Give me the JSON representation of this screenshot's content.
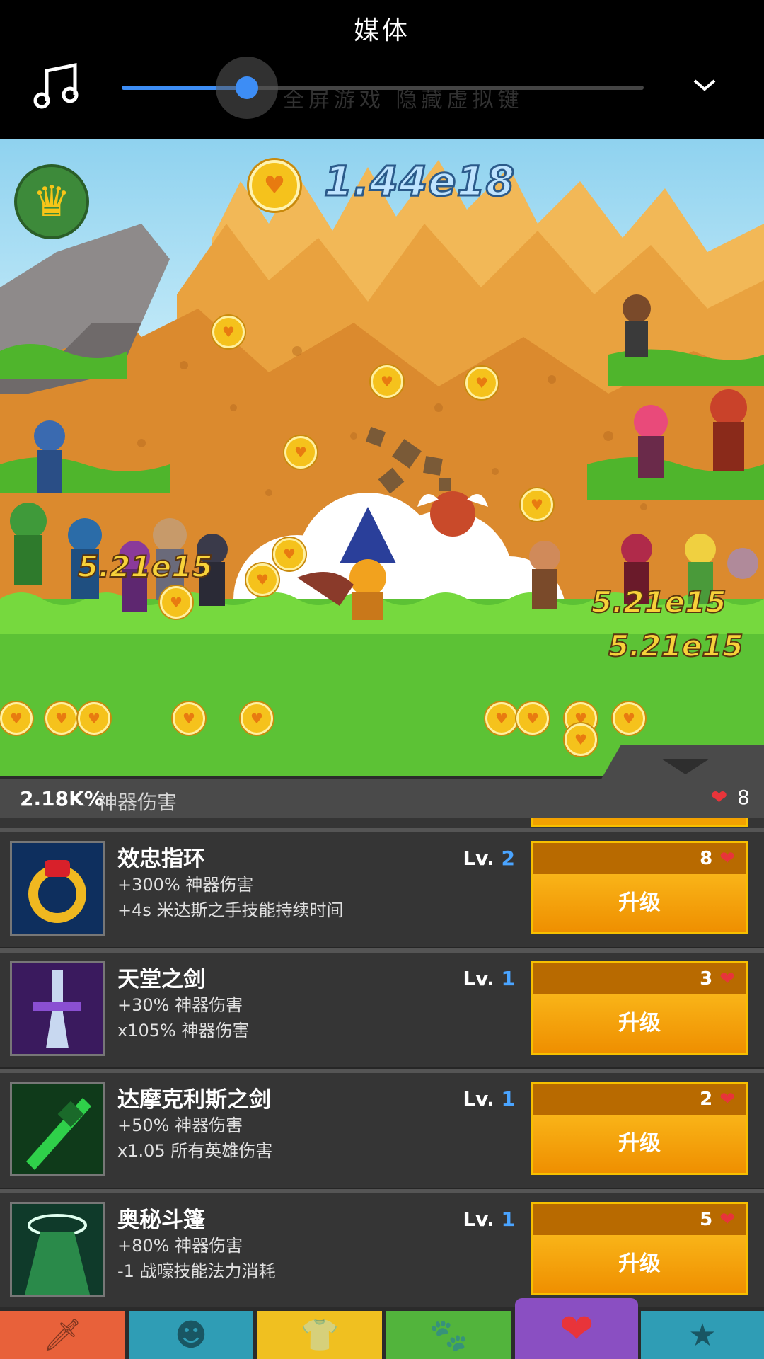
{
  "media": {
    "title": "媒体",
    "ghost_text": "全屏游戏 隐藏虚拟键",
    "volume_fraction": 0.24
  },
  "hud": {
    "gold_amount": "1.44e18",
    "damage_popups": [
      "5.21e15",
      "5.21e15",
      "5.21e15"
    ]
  },
  "artifacts": {
    "total_damage_value": "2.18K%",
    "total_damage_label": "神器伤害",
    "relics": "8"
  },
  "items": [
    {
      "name": "效忠指环",
      "level_prefix": "Lv.",
      "level": "2",
      "effect1": "+300% 神器伤害",
      "effect2": "+4s 米达斯之手技能持续时间",
      "cost": "8",
      "button": "升级"
    },
    {
      "name": "天堂之剑",
      "level_prefix": "Lv.",
      "level": "1",
      "effect1": "+30% 神器伤害",
      "effect2": "x105% 神器伤害",
      "cost": "3",
      "button": "升级"
    },
    {
      "name": "达摩克利斯之剑",
      "level_prefix": "Lv.",
      "level": "1",
      "effect1": "+50% 神器伤害",
      "effect2": "x1.05 所有英雄伤害",
      "cost": "2",
      "button": "升级"
    },
    {
      "name": "奥秘斗篷",
      "level_prefix": "Lv.",
      "level": "1",
      "effect1": "+80% 神器伤害",
      "effect2": "-1 战嚎技能法力消耗",
      "cost": "5",
      "button": "升级"
    }
  ],
  "tabs": [
    {
      "icon": "sword-icon",
      "color": "#e8613a"
    },
    {
      "icon": "hero-icon",
      "color": "#2f9db5"
    },
    {
      "icon": "armor-icon",
      "color": "#f0c020"
    },
    {
      "icon": "pet-icon",
      "color": "#52b43c"
    },
    {
      "icon": "artifact-heart-icon",
      "color": "#8a4fc2",
      "active": true
    },
    {
      "icon": "star-icon",
      "color": "#2f9db5"
    }
  ]
}
